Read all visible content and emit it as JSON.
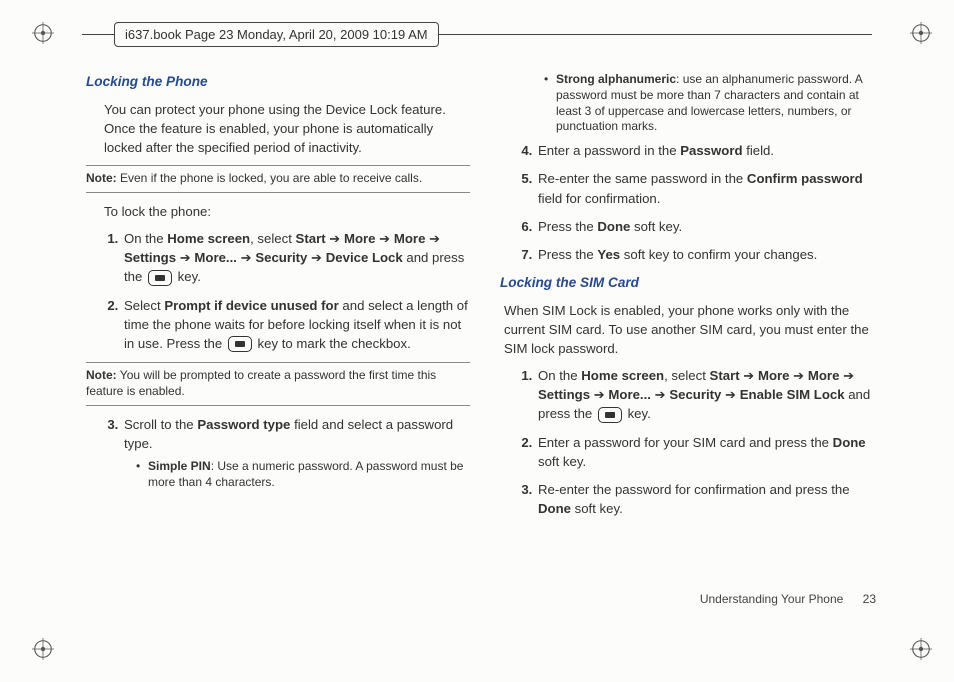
{
  "page_tag": "i637.book  Page 23  Monday, April 20, 2009  10:19 AM",
  "col1": {
    "heading": "Locking the Phone",
    "intro": "You can protect your phone using the Device Lock feature. Once the feature is enabled, your phone is automatically locked after the specified period of inactivity.",
    "note1_label": "Note:",
    "note1_text": " Even if the phone is locked, you are able to receive calls.",
    "lead": "To lock the phone:",
    "step1_a": "On the ",
    "step1_b": "Home screen",
    "step1_c": ", select ",
    "step1_d": "Start",
    "step1_e": "More",
    "step1_f": "More",
    "step1_g": "Settings",
    "step1_h": "More...",
    "step1_i": "Security",
    "step1_j": "Device Lock",
    "step1_k": " and press the ",
    "step1_l": " key.",
    "step2_a": "Select ",
    "step2_b": "Prompt if device unused for",
    "step2_c": " and select a length of time the phone waits for before locking itself when it is not in use. Press the ",
    "step2_d": " key to mark the checkbox.",
    "note2_label": "Note:",
    "note2_text": " You will be prompted to create a password the first time this feature is enabled.",
    "step3_a": "Scroll to the ",
    "step3_b": "Password type",
    "step3_c": " field and select a password type.",
    "bullet1_b": "Simple PIN",
    "bullet1_t": ": Use a numeric password. A password must be more than 4 characters."
  },
  "col2": {
    "bullet2_b": "Strong alphanumeric",
    "bullet2_t": ": use an alphanumeric password. A password must be more than 7 characters and contain at least 3 of uppercase and lowercase letters, numbers, or punctuation marks.",
    "step4_a": "Enter a password in the ",
    "step4_b": "Password",
    "step4_c": " field.",
    "step5_a": "Re-enter the same password in the ",
    "step5_b": "Confirm password",
    "step5_c": " field for confirmation.",
    "step6_a": "Press the ",
    "step6_b": "Done",
    "step6_c": " soft key.",
    "step7_a": "Press the ",
    "step7_b": "Yes",
    "step7_c": " soft key to confirm your changes.",
    "heading2": "Locking the SIM Card",
    "intro2": "When SIM Lock is enabled, your phone works only with the current SIM card. To use another SIM card, you must enter the SIM lock password.",
    "s2step1_a": "On the ",
    "s2step1_b": "Home screen",
    "s2step1_c": ", select ",
    "s2step1_d": "Start",
    "s2step1_e": "More",
    "s2step1_f": "More",
    "s2step1_g": "Settings",
    "s2step1_h": "More...",
    "s2step1_i": "Security",
    "s2step1_j": "Enable SIM Lock",
    "s2step1_k": " and press the ",
    "s2step1_l": " key.",
    "s2step2_a": "Enter a password for your SIM card and press the ",
    "s2step2_b": "Done",
    "s2step2_c": " soft key.",
    "s2step3_a": "Re-enter the password for confirmation and press the ",
    "s2step3_b": "Done",
    "s2step3_c": " soft key."
  },
  "footer_section": "Understanding Your Phone",
  "footer_page": "23",
  "arrow_glyph": " ➔ "
}
